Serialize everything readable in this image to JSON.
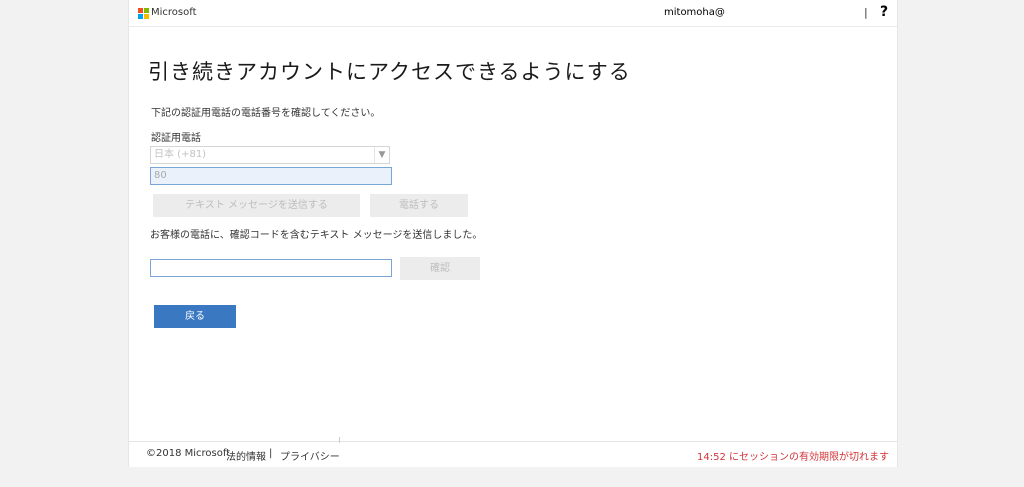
{
  "header": {
    "brand": "Microsoft",
    "user": "mitomoha@",
    "separator": "|",
    "help": "?"
  },
  "main": {
    "title": "引き続きアカウントにアクセスできるようにする",
    "description": "下記の認証用電話の電話番号を確認してください。",
    "phone_label": "認証用電話",
    "country_select": "日本 (+81)",
    "phone_value": "80",
    "send_sms_button": "テキスト メッセージを送信する",
    "call_button": "電話する",
    "sent_message": "お客様の電話に、確認コードを含むテキスト メッセージを送信しました。",
    "code_value": "",
    "confirm_button": "確認",
    "back_button": "戻る"
  },
  "footer": {
    "copyright": "©2018 Microsoft",
    "legal": "法的情報",
    "separator": "|",
    "privacy": "プライバシー",
    "session_message": "14:52 にセッションの有効期限が切れます"
  },
  "colors": {
    "primary": "#3b78c2",
    "warning": "#d13438",
    "page_bg": "#f2f2f2"
  }
}
